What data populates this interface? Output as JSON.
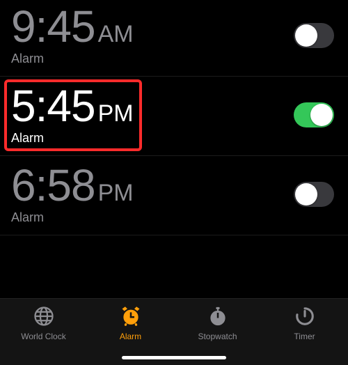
{
  "alarms": [
    {
      "time": "9:45",
      "ampm": "AM",
      "label": "Alarm",
      "enabled": false,
      "highlighted": false
    },
    {
      "time": "5:45",
      "ampm": "PM",
      "label": "Alarm",
      "enabled": true,
      "highlighted": true
    },
    {
      "time": "6:58",
      "ampm": "PM",
      "label": "Alarm",
      "enabled": false,
      "highlighted": false
    }
  ],
  "tabs": {
    "world_clock": "World Clock",
    "alarm": "Alarm",
    "stopwatch": "Stopwatch",
    "timer": "Timer"
  },
  "colors": {
    "accent": "#ff9f0a",
    "toggle_on": "#34c759",
    "highlight": "#ff2b2b",
    "inactive_text": "#8e8e93"
  }
}
